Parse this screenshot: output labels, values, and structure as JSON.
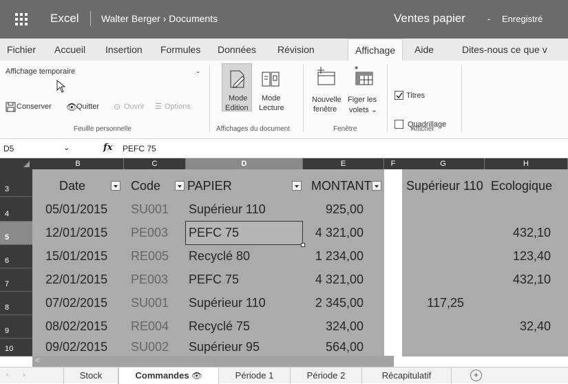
{
  "titlebar": {
    "app": "Excel",
    "breadcrumb": "Walter Berger › Documents",
    "document": "Ventes papier",
    "dash": "-",
    "status": "Enregistré"
  },
  "tabs": [
    "Fichier",
    "Accueil",
    "Insertion",
    "Formules",
    "Données",
    "Révision",
    "Affichage",
    "Aide",
    "Dites-nous ce que v"
  ],
  "active_tab": "Affichage",
  "ribbon": {
    "sheet_view_select": "Affichage temporaire",
    "conserver": "Conserver",
    "quitter": "Quitter",
    "ouvrir": "Ouvrir",
    "options": "Options",
    "group_feuille": "Feuille personnelle",
    "mode_edition_1": "Mode",
    "mode_edition_2": "Edition",
    "mode_lecture_1": "Mode",
    "mode_lecture_2": "Lecture",
    "group_affichages": "Affichages du document",
    "nouvelle_1": "Nouvelle",
    "nouvelle_2": "fenêtre",
    "figer_1": "Figer les",
    "figer_2": "volets ⌄",
    "group_fenetre": "Fenêtre",
    "titres": "Titres",
    "quadrillage": "Quadrillage",
    "group_afficher": "Afficher"
  },
  "formula_bar": {
    "name_box": "D5",
    "fx": "fx",
    "value": "PEFC 75"
  },
  "columns": [
    "B",
    "C",
    "D",
    "E",
    "F",
    "G",
    "H"
  ],
  "header_row": {
    "row": "3",
    "date": "Date",
    "code": "Code",
    "papier": "PAPIER",
    "montant": "MONTANT",
    "sup110": "Supérieur 110",
    "ecologique": "Ecologique"
  },
  "rows": [
    {
      "row": "4",
      "date": "05/01/2015",
      "code": "SU001",
      "papier": "Supérieur 110",
      "montant": "925,00",
      "g": "",
      "h": ""
    },
    {
      "row": "5",
      "date": "12/01/2015",
      "code": "PE003",
      "papier": "PEFC 75",
      "montant": "4 321,00",
      "g": "",
      "h": "432,10"
    },
    {
      "row": "6",
      "date": "15/01/2015",
      "code": "RE005",
      "papier": "Recyclé 80",
      "montant": "1 234,00",
      "g": "",
      "h": "123,40"
    },
    {
      "row": "7",
      "date": "22/01/2015",
      "code": "PE003",
      "papier": "PEFC 75",
      "montant": "4 321,00",
      "g": "",
      "h": "432,10"
    },
    {
      "row": "8",
      "date": "07/02/2015",
      "code": "SU001",
      "papier": "Supérieur 110",
      "montant": "2 345,00",
      "g": "117,25",
      "h": ""
    },
    {
      "row": "9",
      "date": "08/02/2015",
      "code": "RE004",
      "papier": "Recyclé 75",
      "montant": "324,00",
      "g": "",
      "h": "32,40"
    },
    {
      "row": "10",
      "date": "09/02/2015",
      "code": "SU002",
      "papier": "Supérieur 95",
      "montant": "564,00",
      "g": "",
      "h": ""
    }
  ],
  "sheet_tabs": [
    "Stock",
    "Commandes",
    "Période 1",
    "Période 2",
    "Récapitulatif"
  ],
  "active_sheet": "Commandes",
  "scroll_left": "<",
  "nav_prev": "‹",
  "nav_next": "›",
  "add_sheet": "+"
}
